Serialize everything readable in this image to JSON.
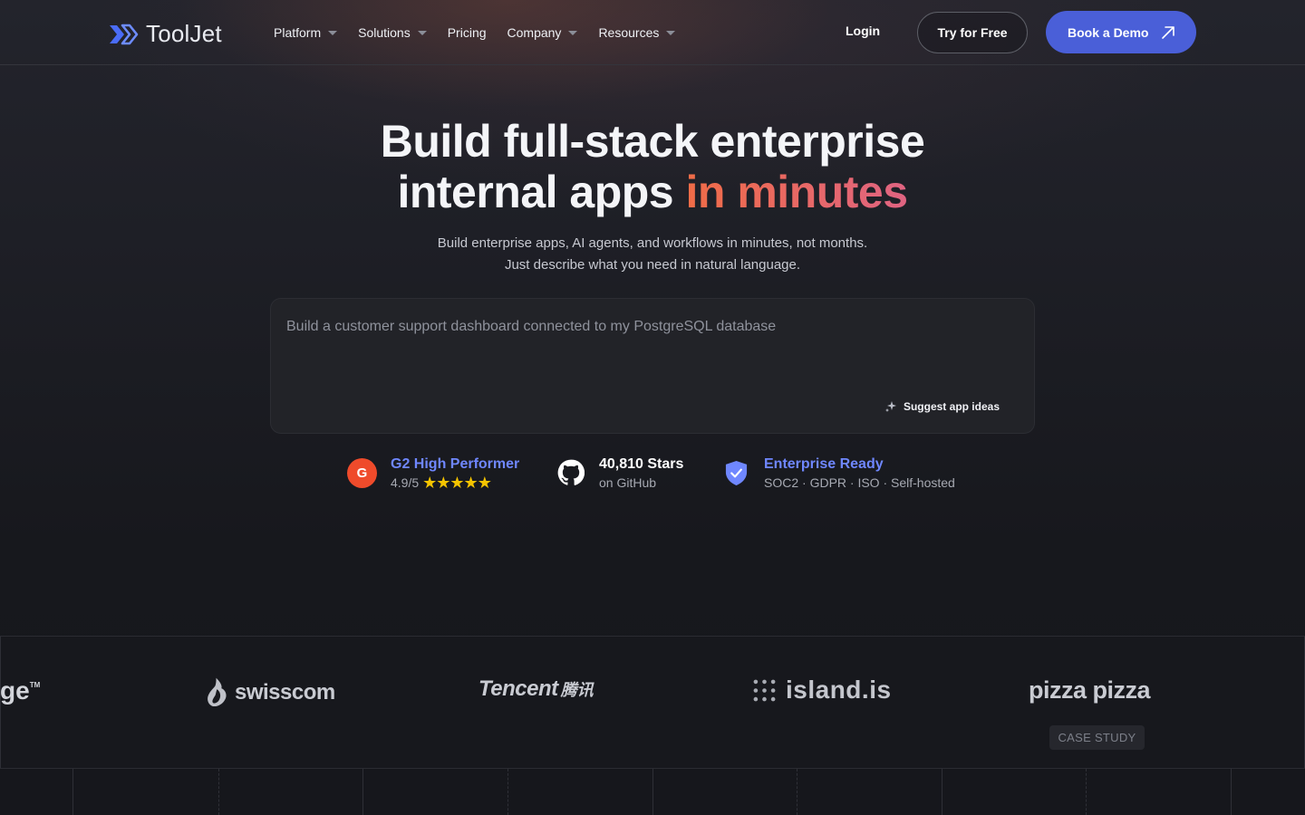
{
  "nav": {
    "brand": "ToolJet",
    "menu": [
      {
        "label": "Platform",
        "has_dropdown": true
      },
      {
        "label": "Solutions",
        "has_dropdown": true
      },
      {
        "label": "Pricing",
        "has_dropdown": false
      },
      {
        "label": "Company",
        "has_dropdown": true
      },
      {
        "label": "Resources",
        "has_dropdown": true
      }
    ],
    "login_label": "Login",
    "try_label": "Try for Free",
    "demo_label": "Book a Demo"
  },
  "hero": {
    "title_line1": "Build full-stack enterprise",
    "title_line2_plain": "internal apps ",
    "title_line2_accent": "in minutes",
    "subtitle": "Build enterprise apps, AI agents, and workflows in minutes, not months. Just describe what you need in natural language."
  },
  "prompt": {
    "placeholder": "Build a customer support dashboard connected to my PostgreSQL database",
    "suggest_label": "Suggest app ideas"
  },
  "badges": {
    "g2": {
      "icon": "g2-logo-icon",
      "title": "G2 High Performer",
      "rating": "4.9/5",
      "stars": "★★★★★"
    },
    "github": {
      "icon": "github-icon",
      "title": "40,810 Stars",
      "subtitle": "on GitHub"
    },
    "enterprise": {
      "icon": "shield-check-icon",
      "title": "Enterprise Ready",
      "subtitle": "SOC2 · GDPR · ISO · Self-hosted"
    }
  },
  "customers": {
    "logos": [
      "ge™",
      "swisscom",
      "Tencent 腾讯",
      "island.is",
      "pizza pizza"
    ],
    "partial_logo_text": "ge",
    "partial_logo_tm": "TM",
    "swisscom": "swisscom",
    "tencent_latin": "Tencent",
    "tencent_cjk": "腾讯",
    "island": "island.is",
    "pizza": "pizza pizza",
    "case_study_label": "CASE STUDY"
  },
  "colors": {
    "accent_blue": "#4a5fd8",
    "accent_link": "#6f87ff",
    "accent_orange": "#ee6a4e",
    "g2_red": "#ef4b2b",
    "star_yellow": "#f5c400"
  }
}
